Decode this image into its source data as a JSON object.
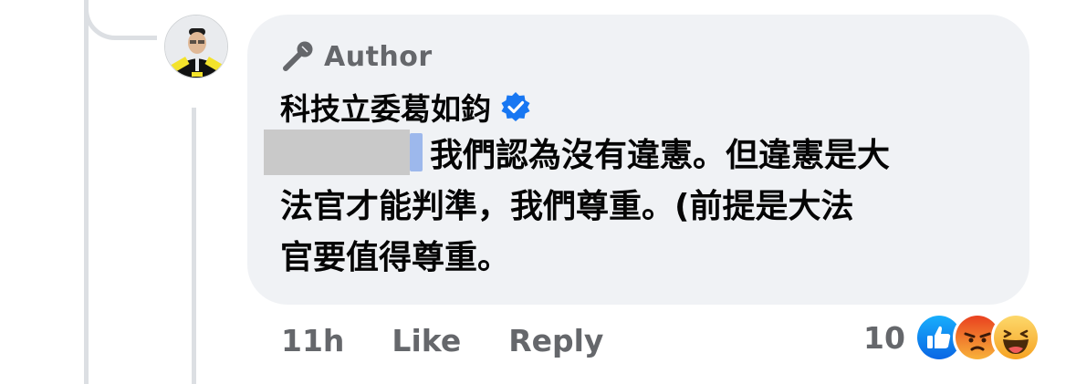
{
  "comment": {
    "badge_label": "Author",
    "author_name": "科技立委葛如鈞",
    "text_line1": "我們認為沒有違憲。但違憲是大",
    "text_line2": "法官才能判準，我們尊重。(前提是大法",
    "text_line3": "官要值得尊重。",
    "timestamp": "11h",
    "like_label": "Like",
    "reply_label": "Reply",
    "reaction_count": "10",
    "reactions": [
      "like-reaction-icon",
      "angry-reaction-icon",
      "haha-reaction-icon"
    ],
    "colors": {
      "bubble": "#f0f2f5",
      "secondary_text": "#65676b",
      "verified": "#1877f2",
      "like": "#1877f2"
    }
  }
}
